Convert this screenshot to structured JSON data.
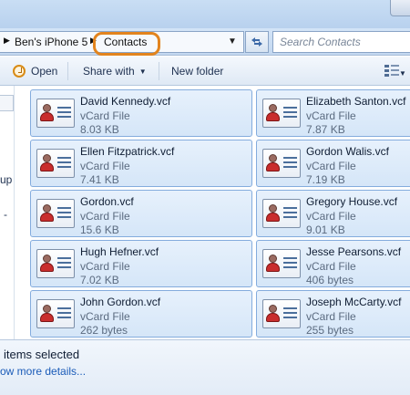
{
  "address": {
    "breadcrumbs": [
      "Ben's iPhone 5",
      "Contacts"
    ]
  },
  "search": {
    "placeholder": "Search Contacts"
  },
  "toolbar": {
    "open_label": "Open",
    "share_label": "Share with",
    "new_folder_label": "New folder"
  },
  "nav": {
    "partial_labels": [
      "up",
      "-"
    ]
  },
  "files": [
    {
      "name": "David Kennedy.vcf",
      "type": "vCard File",
      "size": "8.03 KB"
    },
    {
      "name": "Elizabeth Santon.vcf",
      "type": "vCard File",
      "size": "7.87 KB"
    },
    {
      "name": "Ellen Fitzpatrick.vcf",
      "type": "vCard File",
      "size": "7.41 KB"
    },
    {
      "name": "Gordon Walis.vcf",
      "type": "vCard File",
      "size": "7.19 KB"
    },
    {
      "name": "Gordon.vcf",
      "type": "vCard File",
      "size": "15.6 KB"
    },
    {
      "name": "Gregory House.vcf",
      "type": "vCard File",
      "size": "9.01 KB"
    },
    {
      "name": "Hugh Hefner.vcf",
      "type": "vCard File",
      "size": "7.02 KB"
    },
    {
      "name": "Jesse Pearsons.vcf",
      "type": "vCard File",
      "size": "406 bytes"
    },
    {
      "name": "John Gordon.vcf",
      "type": "vCard File",
      "size": "262 bytes"
    },
    {
      "name": "Joseph McCarty.vcf",
      "type": "vCard File",
      "size": "255 bytes"
    }
  ],
  "details": {
    "selection_text": "items selected",
    "show_details_label": "ow more details..."
  },
  "colors": {
    "highlight_outline": "#e2841e",
    "selection_fill": "#d5e6f8",
    "selection_border": "#84acdd",
    "link": "#1a5bb8"
  }
}
